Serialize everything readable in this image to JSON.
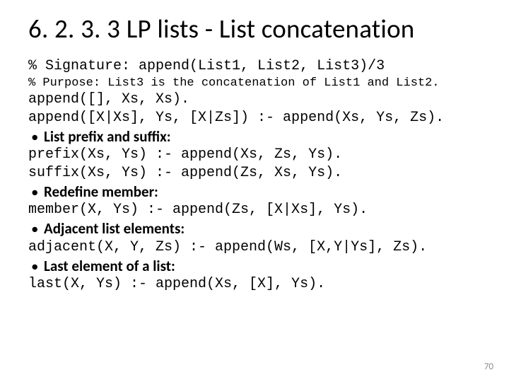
{
  "title": "6. 2. 3. 3 LP lists - List concatenation",
  "sig": "% Signature: append(List1, List2, List3)/3",
  "purpose": "% Purpose: List3 is the concatenation of List1 and List2.",
  "code1": "append([], Xs, Xs).",
  "code2": "append([X|Xs], Ys, [X|Zs]) :- append(Xs, Ys, Zs).",
  "b1": "List prefix and suffix:",
  "code3": "prefix(Xs, Ys) :- append(Xs, Zs, Ys).",
  "code4": "suffix(Xs, Ys) :- append(Zs, Xs, Ys).",
  "b2": "Redefine member:",
  "code5": "member(X, Ys) :- append(Zs, [X|Xs], Ys).",
  "b3": "Adjacent list elements:",
  "code6": "adjacent(X, Y, Zs) :- append(Ws, [X,Y|Ys], Zs).",
  "b4": "Last element of a list:",
  "code7": "last(X, Ys) :- append(Xs, [X], Ys).",
  "page": "70"
}
